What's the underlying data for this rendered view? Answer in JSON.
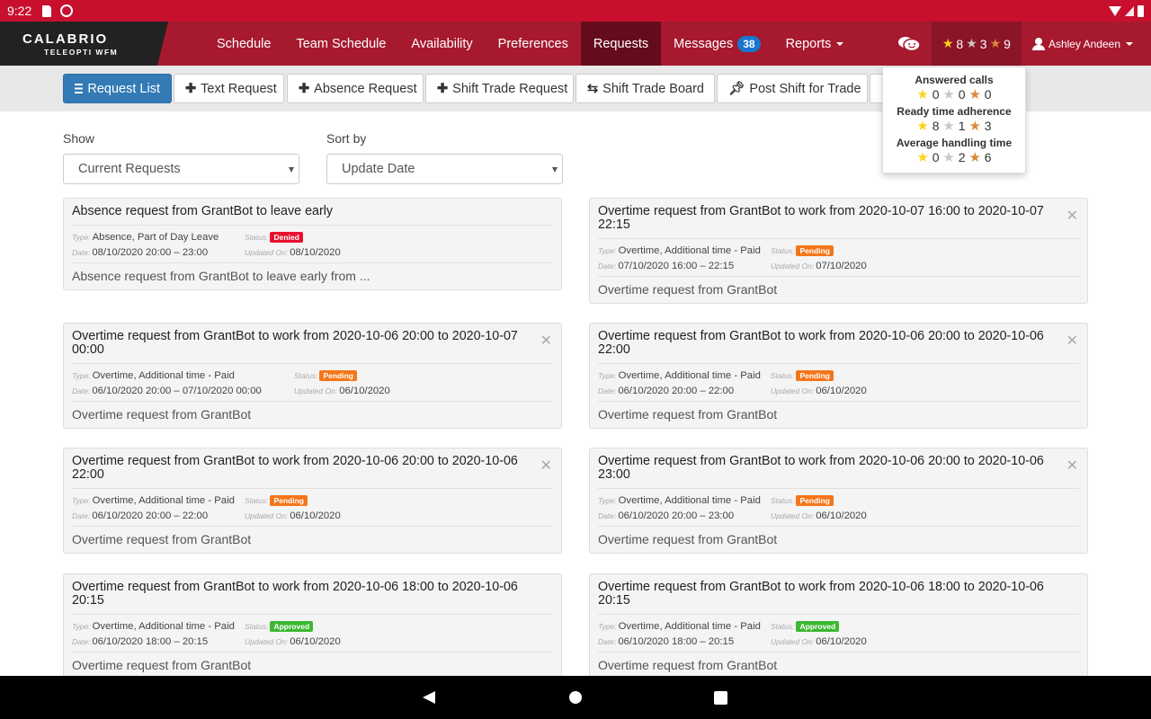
{
  "statusbar": {
    "time": "9:22"
  },
  "brand": {
    "name": "CALABRIO",
    "sub": "TELEOPTI WFM"
  },
  "nav": {
    "items": [
      {
        "label": "Schedule"
      },
      {
        "label": "Team Schedule"
      },
      {
        "label": "Availability"
      },
      {
        "label": "Preferences"
      },
      {
        "label": "Requests",
        "active": true
      },
      {
        "label": "Messages",
        "badge": "38"
      },
      {
        "label": "Reports"
      }
    ],
    "scores": {
      "gold": "8",
      "silver": "3",
      "bronze": "9"
    },
    "user": "Ashley Andeen"
  },
  "toolbar": {
    "request_list": "Request List",
    "text_request": "Text Request",
    "absence_request": "Absence Request",
    "shift_trade_request": "Shift Trade Request",
    "shift_trade_board": "Shift Trade Board",
    "post_shift": "Post Shift for Trade"
  },
  "filters": {
    "show_label": "Show",
    "show_value": "Current Requests",
    "sort_label": "Sort by",
    "sort_value": "Update Date"
  },
  "popover": {
    "sections": [
      {
        "title": "Answered calls",
        "gold": "0",
        "silver": "0",
        "bronze": "0"
      },
      {
        "title": "Ready time adherence",
        "gold": "8",
        "silver": "1",
        "bronze": "3"
      },
      {
        "title": "Average handling time",
        "gold": "0",
        "silver": "2",
        "bronze": "6"
      }
    ]
  },
  "labels": {
    "type": "Type:",
    "status": "Status:",
    "date": "Date:",
    "updated": "Updated On:"
  },
  "requests": [
    {
      "title": "Absence request from GrantBot to leave early",
      "type": "Absence, Part of Day Leave",
      "status": "Denied",
      "date": "08/10/2020 20:00 – 23:00",
      "updated": "08/10/2020",
      "message": "Absence request from GrantBot to leave early from ..."
    },
    {
      "title": "Overtime request from GrantBot to work from 2020-10-07 16:00 to 2020-10-07 22:15",
      "type": "Overtime, Additional time - Paid",
      "status": "Pending",
      "date": "07/10/2020 16:00 – 22:15",
      "updated": "07/10/2020",
      "message": "Overtime request from GrantBot"
    },
    {
      "title": "Overtime request from GrantBot to work from 2020-10-06 20:00 to 2020-10-07 00:00",
      "type": "Overtime, Additional time - Paid",
      "status": "Pending",
      "date": "06/10/2020 20:00 – 07/10/2020 00:00",
      "updated": "06/10/2020",
      "message": "Overtime request from GrantBot"
    },
    {
      "title": "Overtime request from GrantBot to work from 2020-10-06 20:00 to 2020-10-06 22:00",
      "type": "Overtime, Additional time - Paid",
      "status": "Pending",
      "date": "06/10/2020 20:00 – 22:00",
      "updated": "06/10/2020",
      "message": "Overtime request from GrantBot"
    },
    {
      "title": "Overtime request from GrantBot to work from 2020-10-06 20:00 to 2020-10-06 22:00",
      "type": "Overtime, Additional time - Paid",
      "status": "Pending",
      "date": "06/10/2020 20:00 – 22:00",
      "updated": "06/10/2020",
      "message": "Overtime request from GrantBot"
    },
    {
      "title": "Overtime request from GrantBot to work from 2020-10-06 20:00 to 2020-10-06 23:00",
      "type": "Overtime, Additional time - Paid",
      "status": "Pending",
      "date": "06/10/2020 20:00 – 23:00",
      "updated": "06/10/2020",
      "message": "Overtime request from GrantBot"
    },
    {
      "title": "Overtime request from GrantBot to work from 2020-10-06 18:00 to 2020-10-06 20:15",
      "type": "Overtime, Additional time - Paid",
      "status": "Approved",
      "date": "06/10/2020 18:00 – 20:15",
      "updated": "06/10/2020",
      "message": "Overtime request from GrantBot"
    },
    {
      "title": "Overtime request from GrantBot to work from 2020-10-06 18:00 to 2020-10-06 20:15",
      "type": "Overtime, Additional time - Paid",
      "status": "Approved",
      "date": "06/10/2020 18:00 – 20:15",
      "updated": "06/10/2020",
      "message": "Overtime request from GrantBot"
    }
  ],
  "colors": {
    "brand_red": "#a6192e",
    "status_red": "#c8102e",
    "primary": "#337ab7",
    "denied": "#e8102e",
    "pending": "#f5761a",
    "approved": "#3cb832"
  }
}
